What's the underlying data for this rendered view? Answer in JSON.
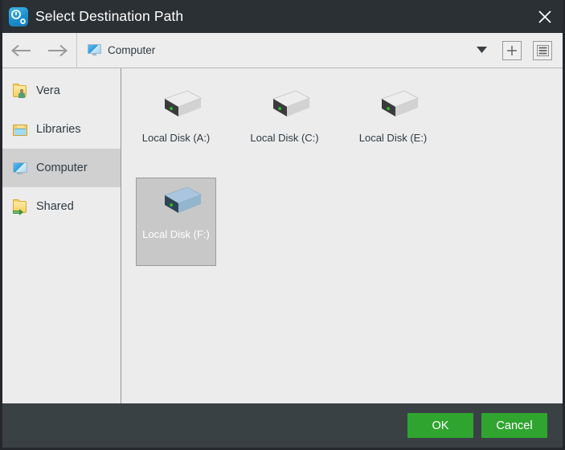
{
  "window": {
    "title": "Select Destination Path",
    "app_icon": "backup-clock-icon",
    "close_label": "close-icon"
  },
  "toolbar": {
    "back_icon": "arrow-left-icon",
    "forward_icon": "arrow-right-icon",
    "path_icon": "computer-monitor-icon",
    "path_label": "Computer",
    "dropdown_icon": "chevron-down-icon",
    "new_folder_label": "+",
    "new_folder_icon": "plus-icon",
    "view_icon": "list-view-icon"
  },
  "sidebar": {
    "items": [
      {
        "label": "Vera",
        "icon": "user-folder-icon",
        "selected": false
      },
      {
        "label": "Libraries",
        "icon": "libraries-icon",
        "selected": false
      },
      {
        "label": "Computer",
        "icon": "computer-monitor-icon",
        "selected": true
      },
      {
        "label": "Shared",
        "icon": "shared-folder-icon",
        "selected": false
      }
    ]
  },
  "content": {
    "items": [
      {
        "label": "Local Disk (A:)",
        "icon": "hard-disk-icon",
        "selected": false
      },
      {
        "label": "Local Disk (C:)",
        "icon": "hard-disk-icon",
        "selected": false
      },
      {
        "label": "Local Disk (E:)",
        "icon": "hard-disk-icon",
        "selected": false
      },
      {
        "label": "Local Disk (F:)",
        "icon": "hard-disk-icon",
        "selected": true
      }
    ]
  },
  "footer": {
    "ok_label": "OK",
    "cancel_label": "Cancel"
  },
  "colors": {
    "titlebar": "#2b3034",
    "footer": "#3a4145",
    "accent_green": "#2fa52f",
    "selection_gray": "#c8c8c8",
    "sidebar_selection": "#d0d0d0",
    "panel": "#ececec"
  }
}
